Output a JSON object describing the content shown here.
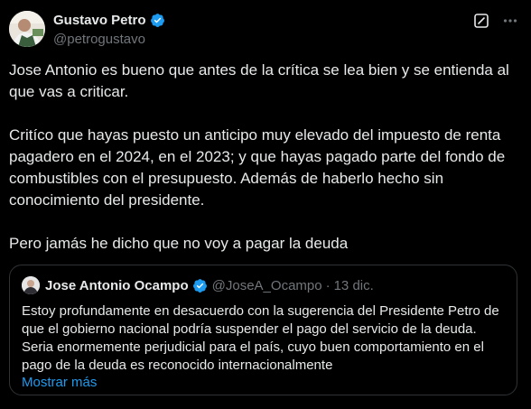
{
  "author": {
    "name": "Gustavo Petro",
    "handle": "@petrogustavo"
  },
  "icons": {
    "verified": "verified-badge-icon",
    "grok": "grok-icon",
    "more": "more-options-icon"
  },
  "colors": {
    "background": "#000000",
    "text": "#e7e9ea",
    "secondary": "#71767b",
    "accent": "#1d9bf0",
    "border": "#2f3336"
  },
  "tweet": {
    "paragraphs": [
      "Jose Antonio es bueno que antes de la crítica se lea bien y se entienda al que vas a criticar.",
      "Critíco que hayas puesto un anticipo muy elevado del impuesto de renta pagadero en el 2024, en el 2023; y que hayas pagado parte del fondo de combustibles con el presupuesto. Además de haberlo hecho sin conocimiento del presidente.",
      "Pero jamás he dicho que no voy a pagar la deuda"
    ]
  },
  "quote": {
    "name": "Jose Antonio Ocampo",
    "handle": "@JoseA_Ocampo",
    "separator": "·",
    "date": "13 dic.",
    "text": "Estoy profundamente en desacuerdo con la sugerencia del Presidente Petro de que el gobierno nacional podría suspender el pago del servicio de la deuda. Seria enormemente perjudicial para el país, cuyo buen comportamiento en el pago de la deuda es reconocido internacionalmente",
    "show_more": "Mostrar más"
  }
}
